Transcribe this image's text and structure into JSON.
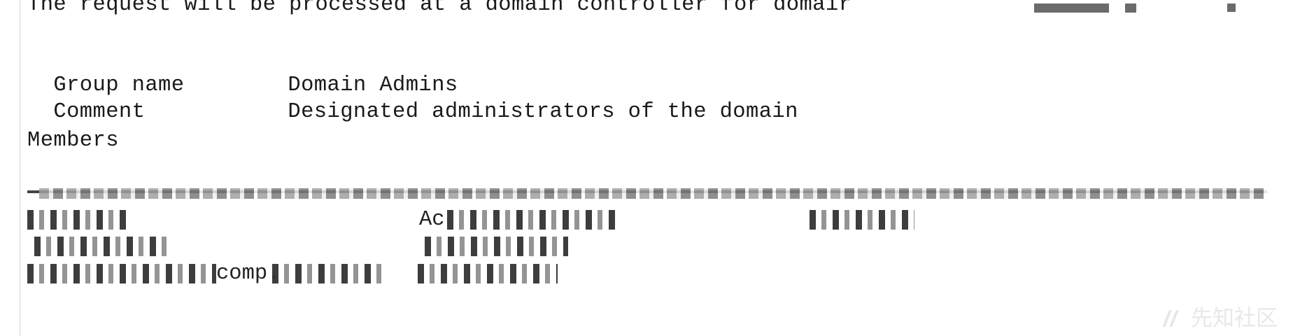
{
  "terminal": {
    "request_line": "The request will be processed at a domain controller for domair",
    "group_label": "Group name",
    "group_value": "Domain Admins",
    "comment_label": "Comment",
    "comment_value": "Designated administrators of the domain",
    "members_label": "Members",
    "row1_hint": "Ac",
    "row2_hint": "",
    "row3_hint": "comp."
  },
  "watermark": {
    "text": "先知社区"
  }
}
